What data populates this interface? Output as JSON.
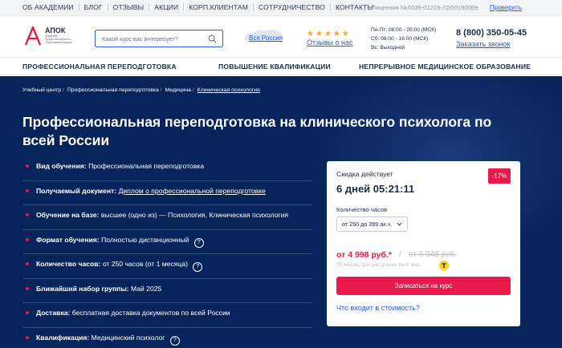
{
  "topbar": {
    "nav": [
      "ОБ АКАДЕМИИ",
      "БЛОГ",
      "ОТЗЫВЫ",
      "АКЦИИ",
      "КОРП.КЛИЕНТАМ",
      "СОТРУДНИЧЕСТВО",
      "КОНТАКТЫ"
    ],
    "license": "Лицензия №Л035-01215-72/00190069",
    "verify": "Проверить"
  },
  "header": {
    "logo_name": "АПОК",
    "logo_sub": "Академия Профессионального Образования Кадров",
    "search_placeholder": "Какой курс вас интересует?",
    "region": "Вся Россия",
    "stars": [
      "★",
      "★",
      "★",
      "★",
      "★"
    ],
    "reviews": "Отзывы о нас",
    "hours": [
      "Пн-Пт: 08:00 - 20:00 (МСК)",
      "Сб: 08:00 - 16:00 (МСК)",
      "Вс: Выходной"
    ],
    "phone": "8 (800) 350-05-45",
    "callback": "Заказать звонок"
  },
  "mainnav": [
    "ПРОФЕССИОНАЛЬНАЯ ПЕРЕПОДГОТОВКА",
    "ПОВЫШЕНИЕ КВАЛИФИКАЦИИ",
    "НЕПРЕРЫВНОЕ МЕДИЦИНСКОЕ ОБРАЗОВАНИЕ"
  ],
  "breadcrumbs": [
    "Учебный центр",
    "Профессиональная переподготовка",
    "Медицина",
    "Клиническая психология"
  ],
  "title": "Профессиональная переподготовка на клинического психолога по всей России",
  "facts": [
    {
      "label": "Вид обучения:",
      "value": "Профессиональная переподготовка"
    },
    {
      "label": "Получаемый документ:",
      "value": "Диплом о профессиональной переподготовке"
    },
    {
      "label": "Обучение на базе:",
      "value": "высшее (одно из) — Психология, Клиническая психология"
    },
    {
      "label": "Формат обучения:",
      "value": "Полностью дистанционный",
      "help": "?"
    },
    {
      "label": "Количество часов:",
      "value": "от 250 часов (от 1 месяца)",
      "help": "?"
    },
    {
      "label": "Ближайший набор группы:",
      "value": "Май 2025"
    },
    {
      "label": "Доставка:",
      "value": "бесплатная доставка документов по всей России"
    },
    {
      "label": "Квалификация:",
      "value": "Медицинский психолог",
      "help": "?"
    }
  ],
  "card": {
    "sale_label": "Скидка действует",
    "timer": "6 дней 05:21:11",
    "badge": "-17%",
    "hours_label": "Количество часов",
    "hours_selected": "от 250 до 399 ак.ч.",
    "price": "от 4 998 руб.*",
    "price_sep": "/",
    "old_price": "от 6 048 руб.",
    "installment": "*В месяц при рассрочке на 6 мес.",
    "enroll": "Записаться на курс",
    "included": "Что входит в стоимость?"
  },
  "colors": {
    "accent": "#e8194b",
    "hero_bg": "#07245a",
    "link": "#2b5bd7",
    "star": "#f5a623"
  }
}
